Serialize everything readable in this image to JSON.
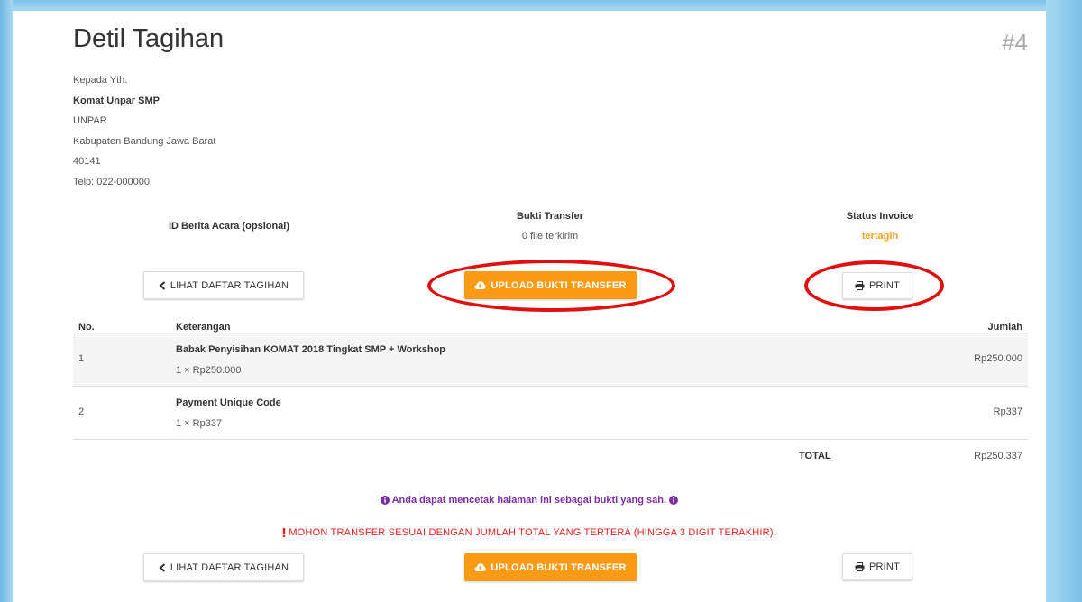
{
  "page": {
    "title": "Detil Tagihan",
    "invoice_number": "#4"
  },
  "recipient": {
    "greeting": "Kepada Yth.",
    "name": "Komat Unpar SMP",
    "organization": "UNPAR",
    "city": "Kabupaten Bandung Jawa Barat",
    "postal_code": "40141",
    "phone": "Telp: 022-000000"
  },
  "summary": {
    "berita_acara_label": "ID Berita Acara (opsional)",
    "bukti_transfer_label": "Bukti Transfer",
    "bukti_transfer_value": "0 file terkirim",
    "status_label": "Status Invoice",
    "status_value": "tertagih"
  },
  "actions": {
    "back_label": "LIHAT DAFTAR TAGIHAN",
    "upload_label": "UPLOAD BUKTI TRANSFER",
    "print_label": "PRINT"
  },
  "table": {
    "headers": {
      "no": "No.",
      "desc": "Keterangan",
      "amount": "Jumlah"
    },
    "rows": [
      {
        "no": "1",
        "name": "Babak Penyisihan KOMAT 2018 Tingkat SMP + Workshop",
        "qty": "1 × Rp250.000",
        "amount": "Rp250.000"
      },
      {
        "no": "2",
        "name": "Payment Unique Code",
        "qty": "1 × Rp337",
        "amount": "Rp337"
      }
    ],
    "total_label": "TOTAL",
    "total_value": "Rp250.337"
  },
  "notes": {
    "info": "Anda dapat mencetak halaman ini sebagai bukti yang sah.",
    "warning": "MOHON TRANSFER SESUAI DENGAN JUMLAH TOTAL YANG TERTERA (HINGGA 3 DIGIT TERAKHIR)."
  },
  "colors": {
    "accent_orange": "#fb9a14",
    "status_orange": "#f7a01c",
    "info_purple": "#7a2fa0",
    "warning_red": "#e02020",
    "annotation_red": "#e01010"
  },
  "icons": {
    "back": "chevron-left-icon",
    "upload": "cloud-upload-icon",
    "print": "printer-icon",
    "info": "info-circle-icon",
    "warning": "exclamation-icon"
  }
}
